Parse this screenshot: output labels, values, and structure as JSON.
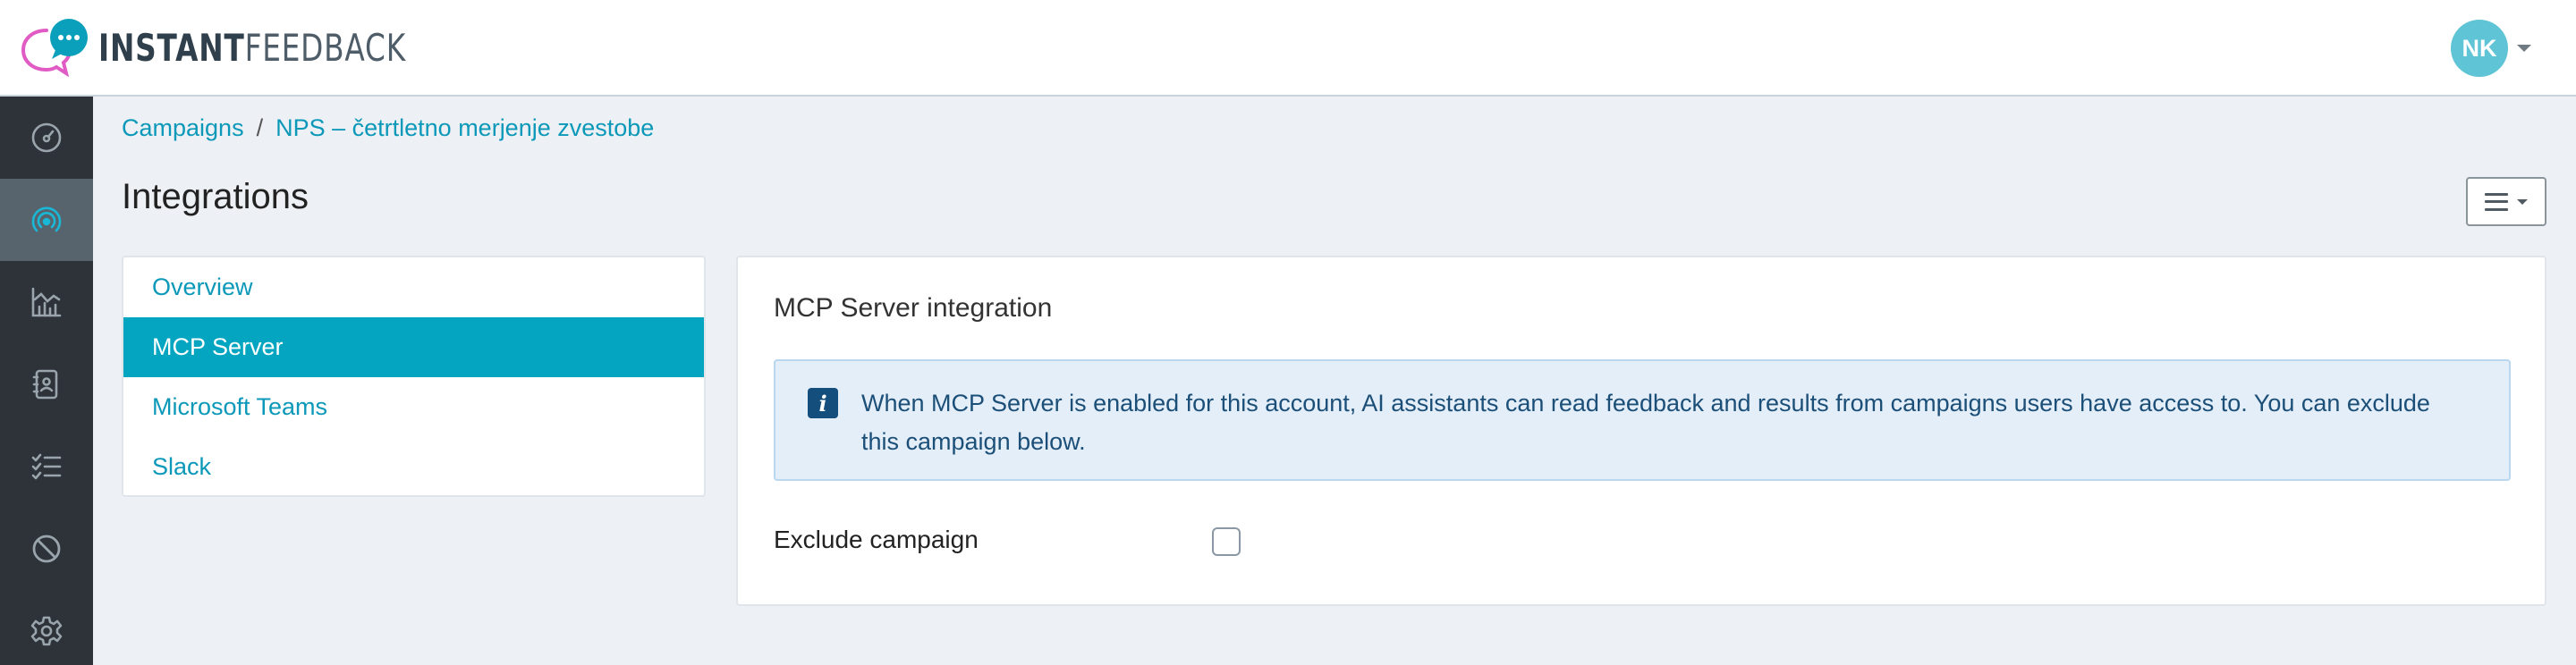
{
  "header": {
    "logo_text_bold": "INSTANT",
    "logo_text_light": "FEEDBACK",
    "logo_icon": "chat-bubbles-logo",
    "user_initials": "NK",
    "avatar_color": "#5ec4d6"
  },
  "sidebar": {
    "items": [
      {
        "icon": "dashboard-icon",
        "active": false
      },
      {
        "icon": "broadcast-icon",
        "active": true
      },
      {
        "icon": "analytics-chart-icon",
        "active": false
      },
      {
        "icon": "contacts-book-icon",
        "active": false
      },
      {
        "icon": "checklist-icon",
        "active": false
      },
      {
        "icon": "blocked-icon",
        "active": false
      },
      {
        "icon": "settings-gear-icon",
        "active": false
      }
    ]
  },
  "breadcrumb": {
    "items": [
      "Campaigns",
      "NPS – četrtletno merjenje zvestobe"
    ],
    "separator": "/"
  },
  "page": {
    "title": "Integrations",
    "menu_icon": "hamburger-icon"
  },
  "subnav": {
    "items": [
      {
        "label": "Overview",
        "active": false
      },
      {
        "label": "MCP Server",
        "active": true
      },
      {
        "label": "Microsoft Teams",
        "active": false
      },
      {
        "label": "Slack",
        "active": false
      }
    ]
  },
  "panel": {
    "title": "MCP Server integration",
    "info_text": "When MCP Server is enabled for this account, AI assistants can read feedback and results from campaigns users have access to. You can exclude this campaign below.",
    "info_icon": "info-icon",
    "exclude_label": "Exclude campaign",
    "exclude_checked": false
  },
  "colors": {
    "accent": "#03a5c0",
    "link": "#0c98b8",
    "sidebar_bg": "#2d3339",
    "sidebar_active": "#57646e",
    "info_bg": "#e3eef9",
    "info_text": "#1c4f78"
  }
}
